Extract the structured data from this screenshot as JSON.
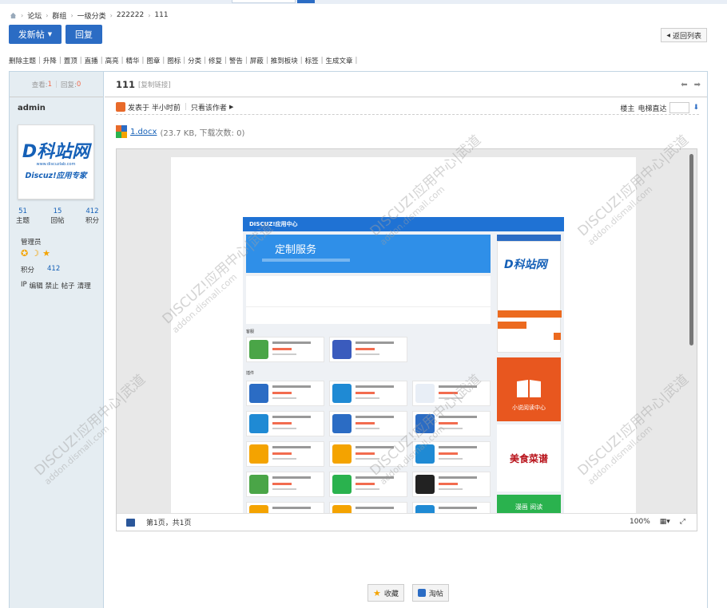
{
  "breadcrumb": {
    "items": [
      "论坛",
      "群组",
      "一级分类",
      "222222",
      "111"
    ]
  },
  "actions_top": {
    "new_post": "发新帖",
    "reply": "回复",
    "back": "返回列表"
  },
  "modbar": {
    "items": [
      "删除主题",
      "升降",
      "置顶",
      "直播",
      "高亮",
      "精华",
      "图章",
      "图标",
      "分类",
      "修复",
      "警告",
      "屏蔽",
      "推到板块",
      "标签",
      "生成文章"
    ]
  },
  "side": {
    "view_label": "查看:",
    "views": "1",
    "reply_label": "回复:",
    "replies": "0",
    "author": "admin",
    "avatar": {
      "logo": "D科站网",
      "logo_sub": "www.discuzlab.com",
      "tagline": "Discuz!应用专家"
    },
    "stats": [
      {
        "num": "51",
        "label": "主题"
      },
      {
        "num": "15",
        "label": "回帖"
      },
      {
        "num": "412",
        "label": "积分"
      }
    ],
    "group": "管理员",
    "credit_label": "积分",
    "credit_value": "412",
    "links": [
      "IP",
      "编辑",
      "禁止",
      "帖子",
      "清理"
    ]
  },
  "thread": {
    "title": "111",
    "copy_link": "[复制链接]"
  },
  "post": {
    "posted": "发表于 半小时前",
    "only_author": "只看该作者",
    "floor": "楼主",
    "elevator": "电梯直达"
  },
  "attachment": {
    "name": "1.docx",
    "meta": "(23.7 KB, 下载次数: 0)"
  },
  "preview": {
    "site_name": "DISCUZ!应用中心",
    "banner_title": "定制服务",
    "side_logo": "D科站网",
    "novel": "小说阅读中心",
    "food": "美食菜谱",
    "read": "漫画 阅读",
    "section_a": "客服",
    "section_b": "插件",
    "page_info": "第1页，共1页",
    "zoom": "100%"
  },
  "watermark": {
    "text": "DISCUZ!应用中心|武道",
    "sub": "addon.dismall.com"
  },
  "bottom_actions": {
    "favorite": "收藏",
    "taobao": "淘帖"
  },
  "colors": {
    "primary": "#2b6cc4",
    "side_bg": "#e5edf2",
    "link": "#1560b7",
    "accent": "#f26c4f"
  }
}
